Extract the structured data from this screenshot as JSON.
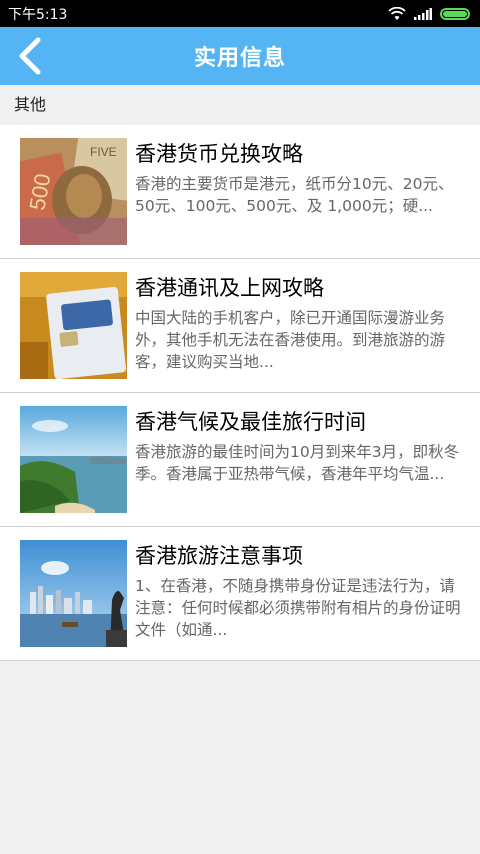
{
  "status": {
    "time": "下午5:13"
  },
  "header": {
    "title": "实用信息"
  },
  "section": {
    "label": "其他"
  },
  "items": [
    {
      "title": "香港货币兑换攻略",
      "desc": "香港的主要货币是港元，纸币分10元、20元、50元、100元、500元、及 1,000元；硬...",
      "icon": "banknotes-image"
    },
    {
      "title": "香港通讯及上网攻略",
      "desc": "中国大陆的手机客户，除已开通国际漫游业务外，其他手机无法在香港使用。到港旅游的游客，建议购买当地...",
      "icon": "sim-card-image"
    },
    {
      "title": "香港气候及最佳旅行时间",
      "desc": "香港旅游的最佳时间为10月到来年3月，即秋冬季。香港属于亚热带气候，香港年平均气温...",
      "icon": "coast-landscape-image"
    },
    {
      "title": "香港旅游注意事项",
      "desc": "1、在香港，不随身携带身份证是违法行为，请注意：任何时候都必须携带附有相片的身份证明文件（如通...",
      "icon": "harbour-skyline-image"
    }
  ],
  "colors": {
    "appbar": "#55b4f4",
    "battery": "#5cd65c"
  }
}
